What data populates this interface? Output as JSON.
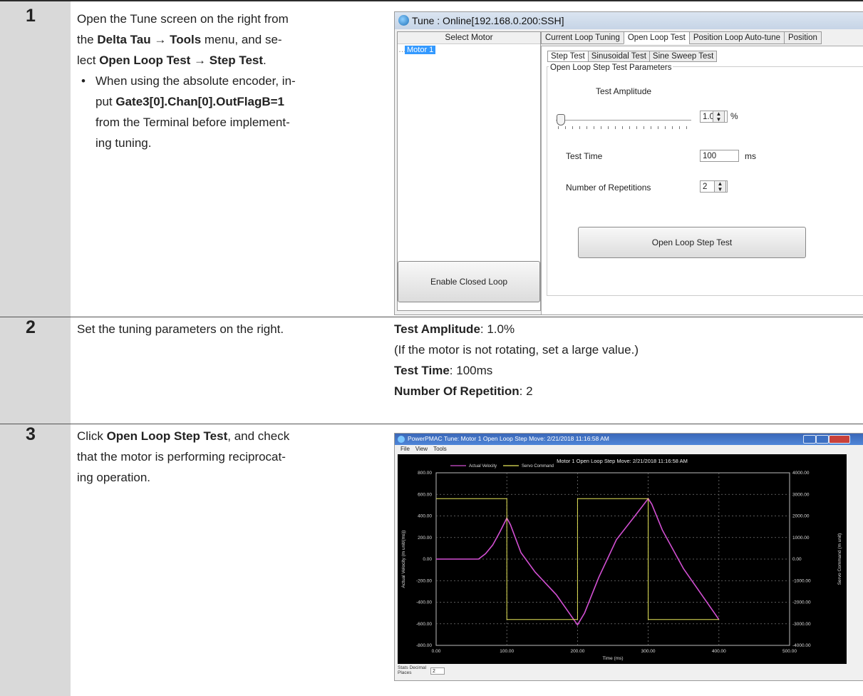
{
  "steps": [
    {
      "num": "1",
      "line1a": "Open the Tune screen on the right from",
      "line2_pre": "the ",
      "line2_b1": "Delta Tau",
      "line2_arrow": " → ",
      "line2_b2": "Tools",
      "line2_post": " menu, and se-",
      "line3_pre": "lect ",
      "line3_b1": "Open Loop Test",
      "line3_arrow": " → ",
      "line3_b2": "Step Test",
      "line3_post": ".",
      "bullet_line1": "When using the absolute encoder, in-",
      "bullet_line2_pre": "put ",
      "bullet_line2_b": "Gate3[0].Chan[0].OutFlagB=1",
      "bullet_line3": "from the Terminal before implement-",
      "bullet_line4": "ing tuning."
    },
    {
      "num": "2",
      "text": "Set the tuning parameters on the right.",
      "p1_b": "Test Amplitude",
      "p1_v": ": 1.0%",
      "p2": "(If the motor is not rotating, set a large value.)",
      "p3_b": "Test Time",
      "p3_v": ": 100ms",
      "p4_b": "Number Of Repetition",
      "p4_v": ": 2"
    },
    {
      "num": "3",
      "line1_b": "Open Loop Step Test",
      "line1_post": ", and check",
      "line2": "that the motor is performing reciprocat-",
      "line3": "ing operation."
    }
  ],
  "tune_window": {
    "title": "Tune : Online[192.168.0.200:SSH]",
    "select_motor": "Select Motor",
    "motor": "Motor 1",
    "enable_button": "Enable Closed Loop",
    "tabs": [
      "Current Loop Tuning",
      "Open Loop Test",
      "Position Loop Auto-tune",
      "Position"
    ],
    "subtabs": [
      "Step Test",
      "Sinusoidal Test",
      "Sine Sweep Test"
    ],
    "group": "Open Loop Step Test Parameters",
    "amp_label": "Test Amplitude",
    "amp_value": "1.0",
    "amp_unit": "%",
    "time_label": "Test Time",
    "time_value": "100",
    "time_unit": "ms",
    "rep_label": "Number of Repetitions",
    "rep_value": "2",
    "run_button": "Open Loop Step Test"
  },
  "plot_window": {
    "title": "PowerPMAC Tune: Motor 1 Open Loop Step Move: 2/21/2018 11:16:58 AM",
    "menu": [
      "File",
      "View",
      "Tools"
    ],
    "status_label1": "Stats Decimal",
    "status_label2": "Places",
    "decimal_value": "2",
    "colors": {
      "velocity": "#d24fd2",
      "command": "#e8e85a"
    }
  },
  "chart_data": {
    "type": "line",
    "title": "Motor 1 Open Loop Step Move: 2/21/2018 11:16:58 AM",
    "xlabel": "Time (ms)",
    "ylabel": "Actual Velocity (m unit/(ms))",
    "y2label": "Servo Command (m unit)",
    "xlim": [
      0,
      500
    ],
    "ylim": [
      -800,
      800
    ],
    "y2lim": [
      -4000,
      4000
    ],
    "x_ticks": [
      "0.00",
      "100.00",
      "200.00",
      "300.00",
      "400.00",
      "500.00"
    ],
    "y_ticks": [
      "800.00",
      "600.00",
      "400.00",
      "200.00",
      "0.00",
      "-200.00",
      "-400.00",
      "-600.00",
      "-800.00"
    ],
    "y2_ticks": [
      "4000.00",
      "3000.00",
      "2000.00",
      "1000.00",
      "0.00",
      "-1000.00",
      "-2000.00",
      "-3000.00",
      "-4000.00"
    ],
    "legend": [
      "Actual Velocity",
      "Servo Command"
    ],
    "series": [
      {
        "name": "Actual Velocity",
        "axis": "left",
        "x": [
          0,
          60,
          70,
          80,
          90,
          100,
          105,
          120,
          140,
          170,
          200,
          210,
          230,
          255,
          280,
          300,
          305,
          320,
          350,
          400
        ],
        "y": [
          0,
          0,
          50,
          130,
          250,
          380,
          320,
          60,
          -120,
          -330,
          -610,
          -500,
          -170,
          180,
          390,
          560,
          510,
          270,
          -90,
          -560
        ]
      },
      {
        "name": "Servo Command",
        "axis": "right",
        "x": [
          0,
          100,
          100,
          200,
          200,
          300,
          300,
          400
        ],
        "y": [
          2800,
          2800,
          -2800,
          -2800,
          2800,
          2800,
          -2800,
          -2800
        ]
      }
    ]
  }
}
